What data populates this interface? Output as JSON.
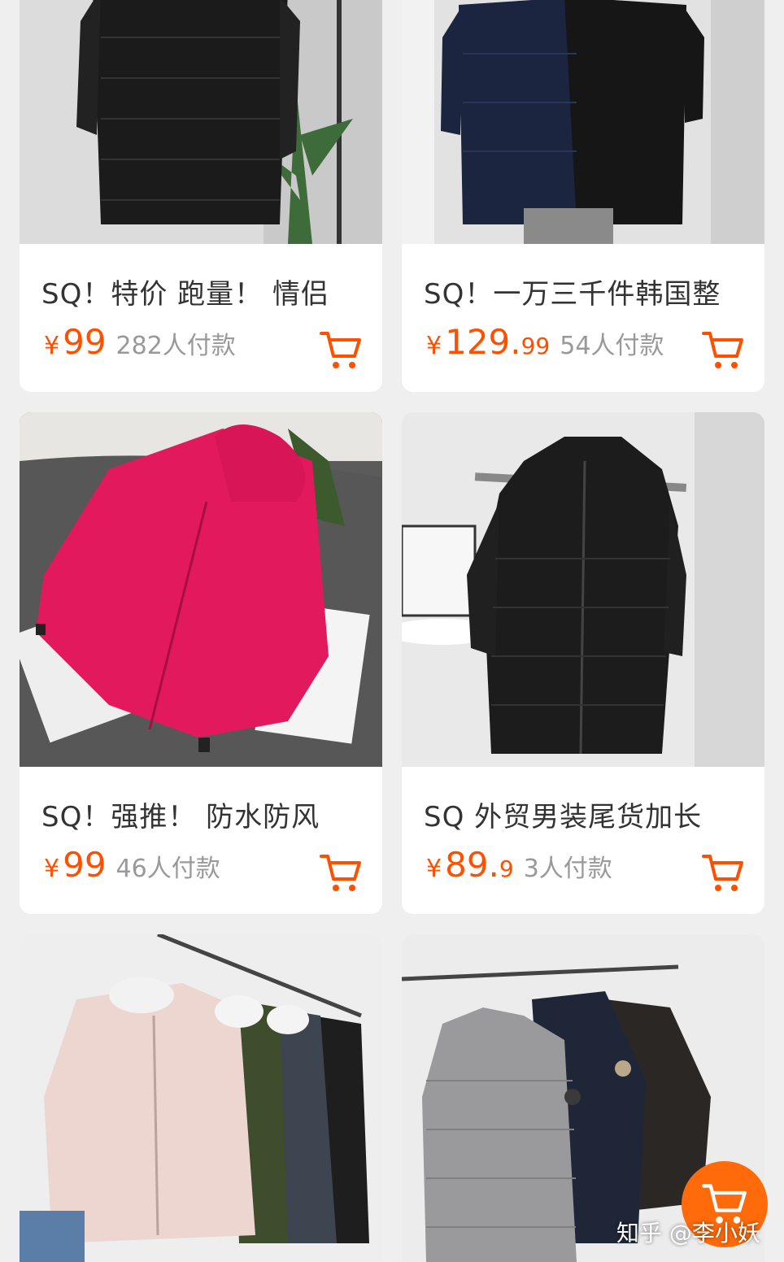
{
  "products": [
    {
      "title": "SQ！特价 跑量！ 情侣",
      "yen": "¥",
      "price_int": "99",
      "price_dec": "",
      "sales": "282人付款",
      "cart_icon": "cart-icon"
    },
    {
      "title": "SQ！一万三千件韩国整",
      "yen": "¥",
      "price_int": "129.",
      "price_dec": "99",
      "sales": "54人付款",
      "cart_icon": "cart-icon"
    },
    {
      "title": "SQ！强推！ 防水防风",
      "yen": "¥",
      "price_int": "99",
      "price_dec": "",
      "sales": "46人付款",
      "cart_icon": "cart-icon"
    },
    {
      "title": "SQ 外贸男装尾货加长",
      "yen": "¥",
      "price_int": "89.",
      "price_dec": "9",
      "sales": "3人付款",
      "cart_icon": "cart-icon"
    },
    {
      "title": "",
      "yen": "",
      "price_int": "",
      "price_dec": "",
      "sales": ""
    },
    {
      "title": "",
      "yen": "",
      "price_int": "",
      "price_dec": "",
      "sales": ""
    }
  ],
  "floating_cart": {
    "icon": "cart-icon"
  },
  "watermark": "知乎 @李小妖",
  "colors": {
    "accent": "#ff5000",
    "float_button": "#ff6a0a",
    "background": "#efefef"
  }
}
